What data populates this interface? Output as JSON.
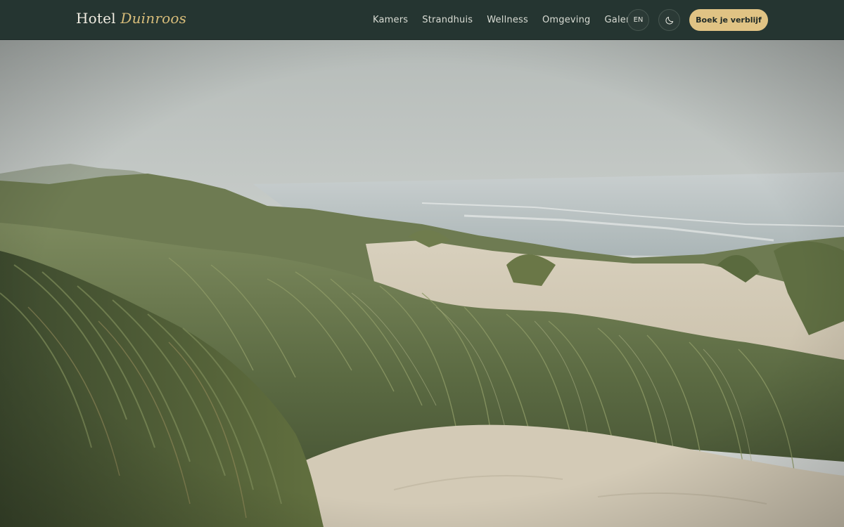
{
  "header": {
    "brand_prefix": "Hotel",
    "brand_name": "Duinroos",
    "nav": [
      {
        "label": "Kamers"
      },
      {
        "label": "Strandhuis"
      },
      {
        "label": "Wellness"
      },
      {
        "label": "Omgeving"
      },
      {
        "label": "Galerij"
      }
    ],
    "language_label": "EN",
    "theme_icon": "moon-icon",
    "book_label": "Boek je verblijf"
  },
  "colors": {
    "header_bg": "#253531",
    "accent_gold": "#e0c384",
    "brand_accent": "#d8bd7a"
  },
  "hero": {
    "scene": "dune-grass-coast-photo"
  }
}
